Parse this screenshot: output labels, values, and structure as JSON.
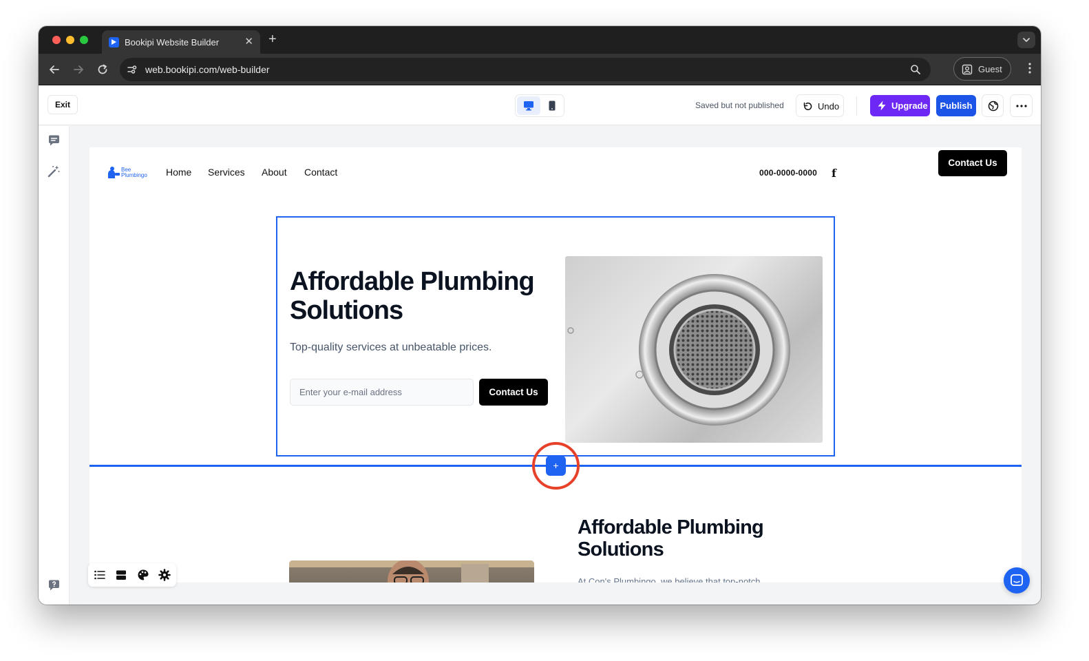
{
  "browser": {
    "tab_title": "Bookipi Website Builder",
    "url": "web.bookipi.com/web-builder",
    "profile_label": "Guest"
  },
  "builder": {
    "exit_label": "Exit",
    "save_status": "Saved but not published",
    "undo_label": "Undo",
    "upgrade_label": "Upgrade",
    "publish_label": "Publish",
    "add_section_label": "+"
  },
  "site": {
    "logo_text_top": "Bee",
    "logo_text_bottom": "Plumbingo",
    "nav_links": [
      "Home",
      "Services",
      "About",
      "Contact"
    ],
    "phone": "000-0000-0000",
    "nav_cta": "Contact Us",
    "hero": {
      "title": "Affordable Plumbing Solutions",
      "subtitle": "Top-quality services at unbeatable prices.",
      "email_placeholder": "Enter your e-mail address",
      "cta": "Contact Us"
    },
    "section2": {
      "title": "Affordable Plumbing Solutions",
      "body": "At Con's Plumbingo, we believe that top-notch"
    }
  },
  "colors": {
    "accent": "#1f63f2",
    "upgrade": "#6d28f5",
    "highlight": "#e8412a"
  },
  "icons": [
    "comment-icon",
    "magic-wand-icon",
    "help-icon",
    "list-icon",
    "sections-icon",
    "palette-icon",
    "settings-icon",
    "desktop-icon",
    "mobile-icon",
    "undo-icon",
    "lightning-icon",
    "globe-icon",
    "more-icon",
    "chat-icon",
    "facebook-icon"
  ]
}
